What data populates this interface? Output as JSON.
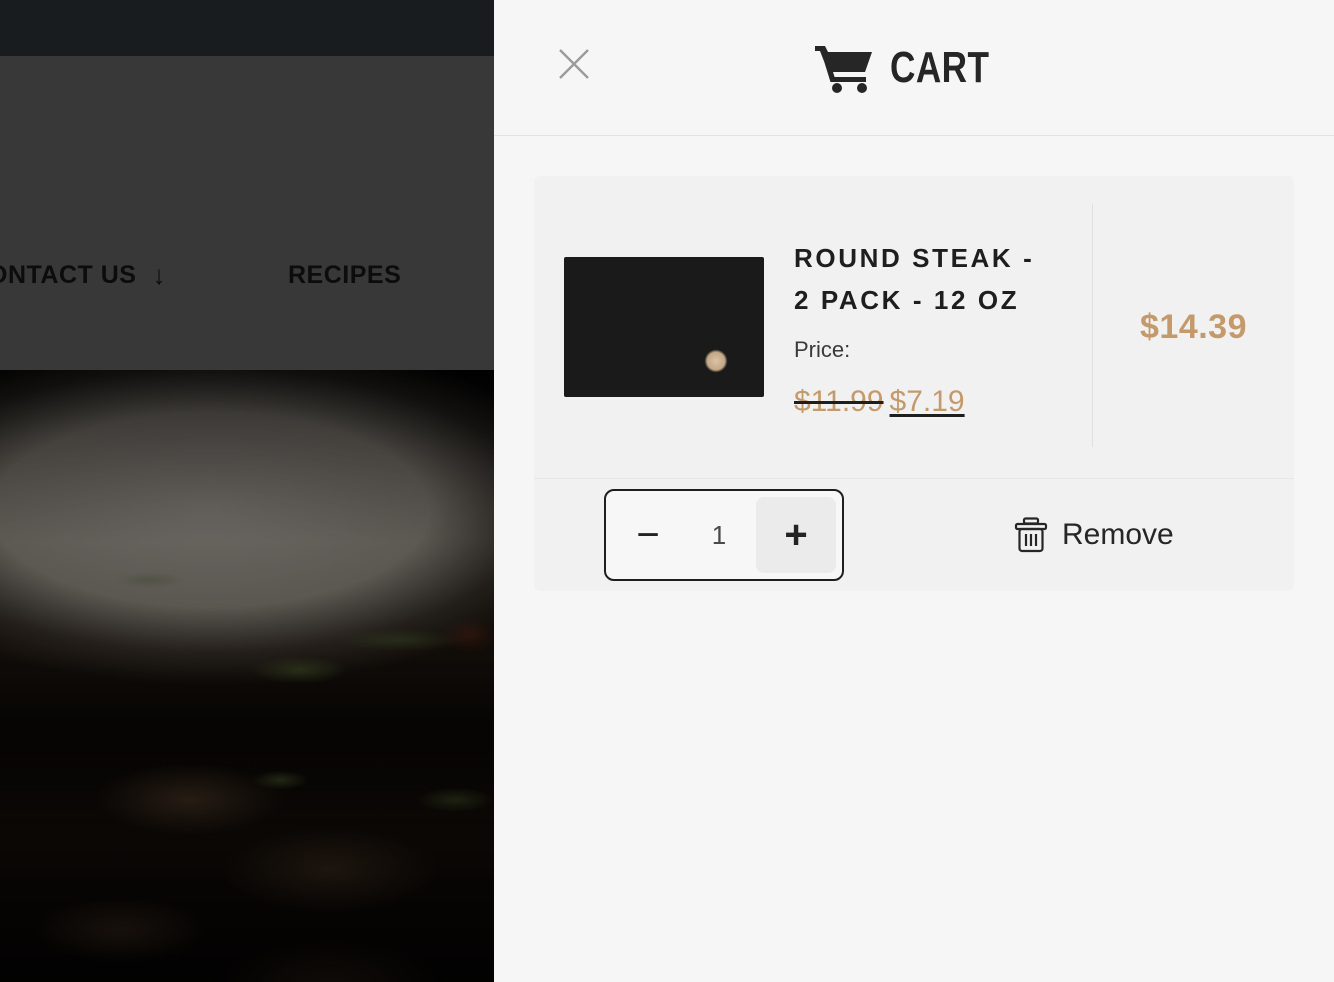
{
  "background_site": {
    "nav": [
      {
        "label": "ONTACT US",
        "icon": "arrow-down-icon",
        "arrow": "↓"
      },
      {
        "label": "RECIPES"
      }
    ],
    "hero_image_alt": "shredded-beef-on-white-plate-photo",
    "topbar_color": "#23272c",
    "navbar_color": "#4e4e4e"
  },
  "drawer": {
    "close_icon": "close-icon",
    "cart_icon": "shopping-cart-icon",
    "title": "CART",
    "item": {
      "thumbnail_alt": "round-steak-on-slate-board-photo",
      "title": "ROUND STEAK - 2 PACK - 12 OZ",
      "price_label": "Price:",
      "price_original": "$11.99",
      "price_sale": "$7.19",
      "line_total": "$14.39",
      "quantity": "1",
      "decrement_label": "−",
      "increment_label": "+",
      "remove_label": "Remove",
      "remove_icon": "trash-icon"
    }
  },
  "colors": {
    "accent_gold": "#c49a6c",
    "text_dark": "#1e1e1e",
    "panel_bg": "#f6f6f6",
    "card_bg": "#f1f1f1"
  }
}
